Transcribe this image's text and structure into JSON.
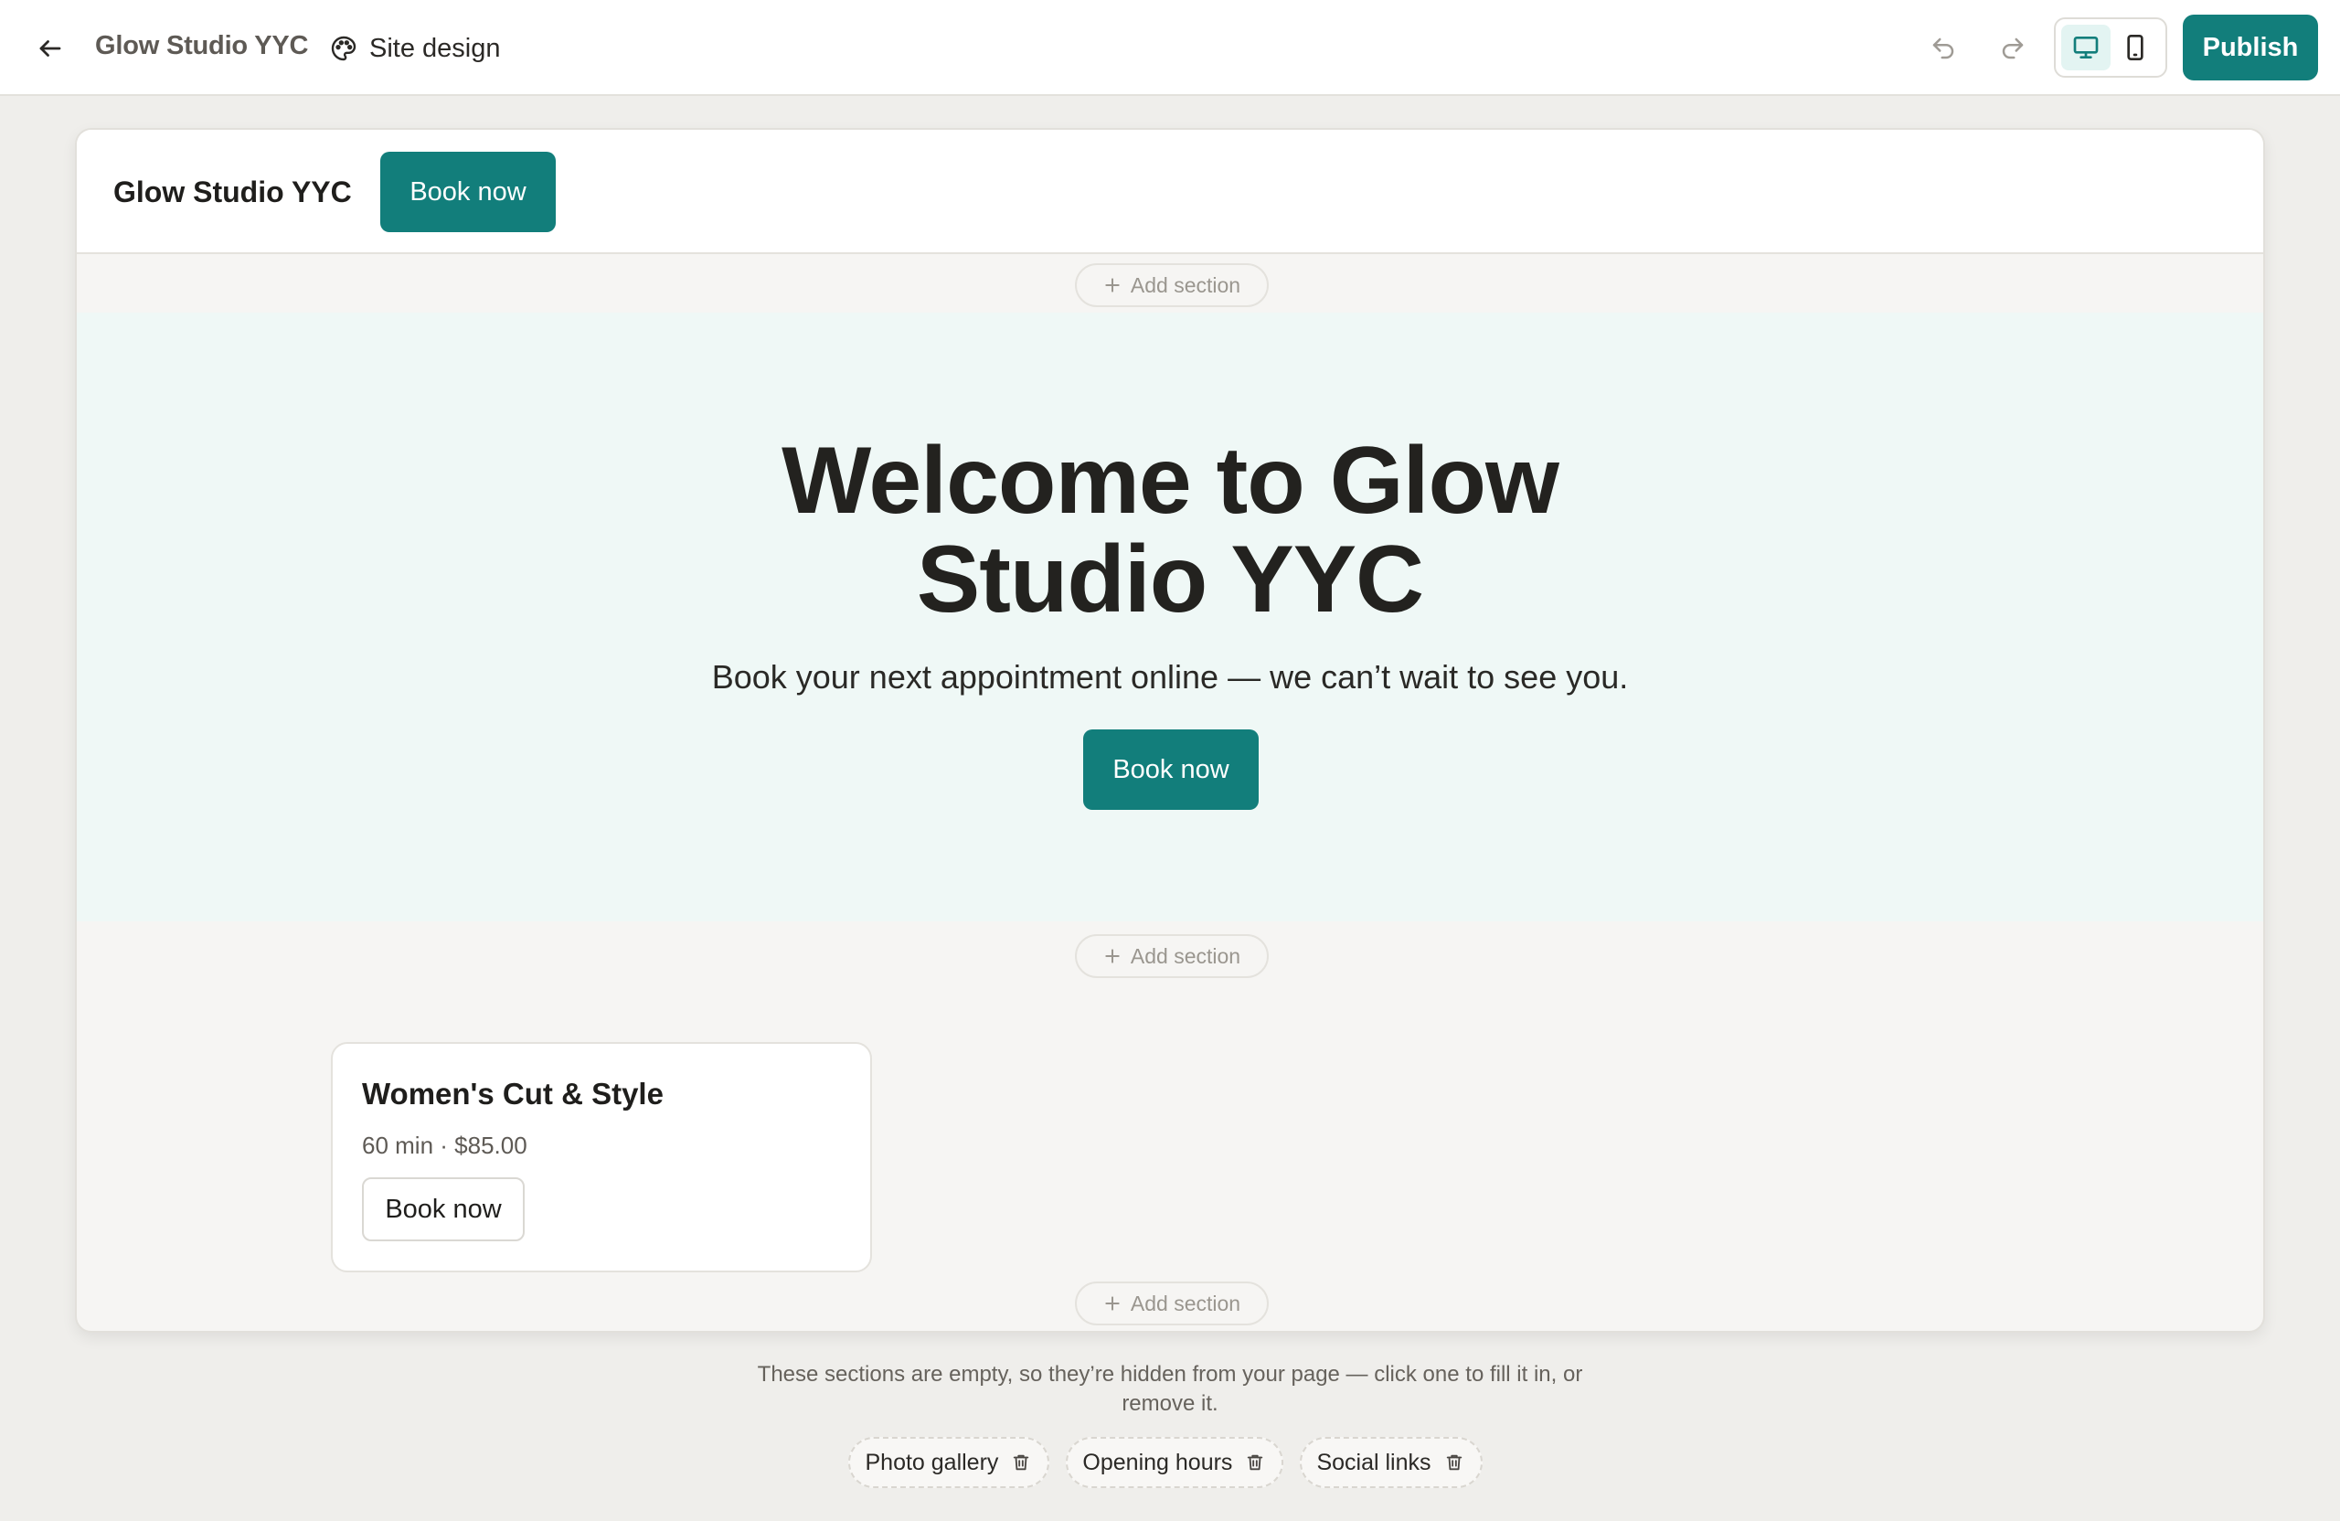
{
  "topbar": {
    "back_icon": "arrow-left-icon",
    "title": "Glow Studio YYC",
    "site_design_label": "Site design",
    "site_design_icon": "palette-icon",
    "undo_icon": "undo-icon",
    "redo_icon": "redo-icon",
    "device_options": [
      {
        "name": "desktop",
        "icon": "monitor-icon",
        "active": true
      },
      {
        "name": "mobile",
        "icon": "phone-icon",
        "active": false
      }
    ],
    "publish_label": "Publish"
  },
  "site": {
    "header": {
      "brand": "Glow Studio YYC",
      "book_label": "Book now"
    },
    "add_section_label": "Add section",
    "hero": {
      "title": "Welcome to Glow Studio YYC",
      "subtitle": "Book your next appointment online — we can’t wait to see you.",
      "book_label": "Book now"
    },
    "services": [
      {
        "name": "Women's Cut & Style",
        "meta": "60 min · $85.00",
        "book_label": "Book now"
      }
    ]
  },
  "hidden_sections": {
    "note": "These sections are empty, so they’re hidden from your page — click one to fill it in, or remove it.",
    "items": [
      {
        "label": "Photo gallery",
        "icon": "trash-icon"
      },
      {
        "label": "Opening hours",
        "icon": "trash-icon"
      },
      {
        "label": "Social links",
        "icon": "trash-icon"
      }
    ]
  },
  "colors": {
    "brand": "#127e7b",
    "hero_bg": "#eff8f6",
    "canvas_bg": "#f6f5f3",
    "page_bg": "#efeeeb"
  }
}
